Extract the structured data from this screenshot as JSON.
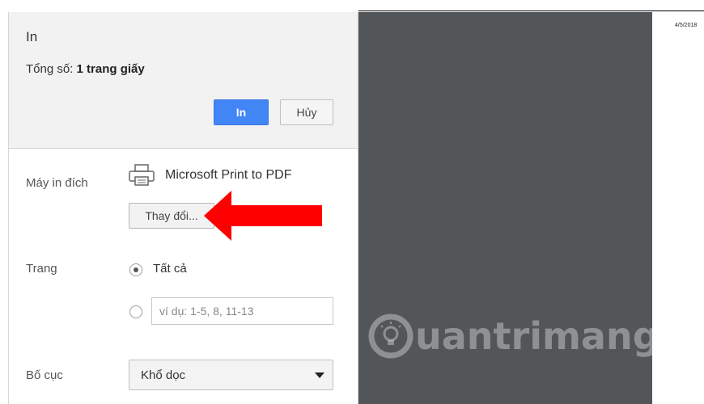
{
  "dialog": {
    "title": "In",
    "total_label": "Tổng số:",
    "total_value": "1 trang giấy",
    "print_button": "In",
    "cancel_button": "Hủy"
  },
  "destination": {
    "label": "Máy in đích",
    "printer_name": "Microsoft Print to PDF",
    "printer_icon": "printer-icon",
    "change_button": "Thay đổi..."
  },
  "pages": {
    "label": "Trang",
    "all_option": "Tất cả",
    "all_selected": true,
    "custom_selected": false,
    "range_placeholder": "ví dụ: 1-5, 8, 11-13"
  },
  "layout": {
    "label": "Bố cục",
    "selected": "Khổ dọc"
  },
  "preview": {
    "date": "4/5/2018",
    "watermark_text": "uantrimang"
  },
  "colors": {
    "print_button": "#4285f4",
    "preview_background": "#525659",
    "arrow": "#ff0000"
  }
}
